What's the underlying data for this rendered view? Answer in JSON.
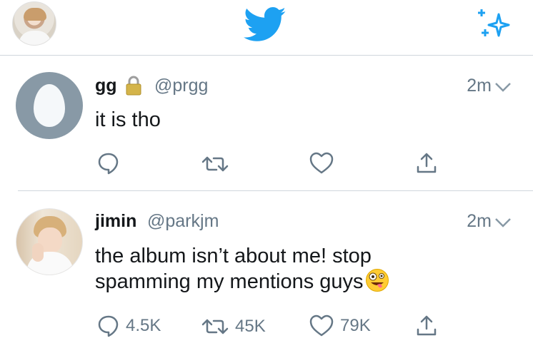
{
  "header": {
    "profile_avatar": "user-avatar",
    "logo": "twitter-bird-icon",
    "compose": "sparkle-icon"
  },
  "colors": {
    "twitter_blue": "#1da1f2",
    "icon_gray": "#657786",
    "divider": "#cfd6dc",
    "egg_bg": "#8899a6"
  },
  "tweets": [
    {
      "name": "gg",
      "protected_icon": "lock-icon",
      "handle": "@prgg",
      "time": "2m",
      "text": "it is tho",
      "avatar": "default-egg-avatar",
      "actions": {
        "reply": "",
        "retweet": "",
        "like": ""
      }
    },
    {
      "name": "jimin",
      "handle": "@parkjm",
      "time": "2m",
      "text_line1": "the album isn’t about me! stop",
      "text_line2": "spamming my mentions guys",
      "emoji": "zany-face-emoji",
      "avatar": "user-photo-avatar",
      "actions": {
        "reply": "4.5K",
        "retweet": "45K",
        "like": "79K"
      }
    }
  ]
}
